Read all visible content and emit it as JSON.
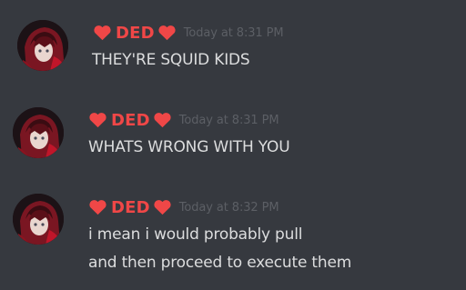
{
  "messages": [
    {
      "username": "DED",
      "timestamp": "Today at 8:31 PM",
      "lines": [
        "THEY'RE SQUID KIDS"
      ]
    },
    {
      "username": "DED",
      "timestamp": "Today at 8:31 PM",
      "lines": [
        "WHATS WRONG WITH YOU"
      ]
    },
    {
      "username": "DED",
      "timestamp": "Today at 8:32 PM",
      "lines": [
        "i mean i would probably pull",
        "and then proceed to execute them"
      ]
    }
  ],
  "colors": {
    "background": "#36393f",
    "username": "#f04747",
    "heart": "#f04747",
    "timestamp": "#5c5f65",
    "message_text": "#dcddde"
  },
  "icons": {
    "name_prefix": "heart-icon",
    "name_suffix": "heart-icon"
  }
}
